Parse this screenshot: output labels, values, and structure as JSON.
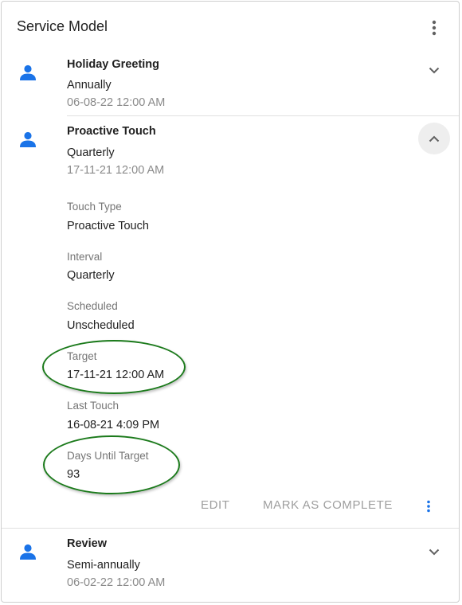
{
  "card": {
    "title": "Service Model"
  },
  "items": [
    {
      "title": "Holiday Greeting",
      "frequency": "Annually",
      "date": "06-08-22 12:00 AM"
    },
    {
      "title": "Proactive Touch",
      "frequency": "Quarterly",
      "date": "17-11-21 12:00 AM"
    },
    {
      "title": "Review",
      "frequency": "Semi-annually",
      "date": "06-02-22 12:00 AM"
    }
  ],
  "details": {
    "fields": [
      {
        "label": "Touch Type",
        "value": "Proactive Touch"
      },
      {
        "label": "Interval",
        "value": "Quarterly"
      },
      {
        "label": "Scheduled",
        "value": "Unscheduled"
      },
      {
        "label": "Target",
        "value": "17-11-21 12:00 AM"
      },
      {
        "label": "Last Touch",
        "value": "16-08-21 4:09 PM"
      },
      {
        "label": "Days Until Target",
        "value": "93"
      }
    ],
    "actions": {
      "edit": "EDIT",
      "mark_complete": "MARK AS COMPLETE"
    }
  },
  "colors": {
    "accent": "#1a73e8",
    "highlight_ring": "#1b7a1b",
    "muted_text": "#8a8a8a",
    "disabled_action": "#9e9e9e"
  },
  "icons": {
    "person": "person-icon",
    "more": "more-vert-icon",
    "expand": "chevron-down-icon",
    "collapse": "chevron-up-icon"
  }
}
